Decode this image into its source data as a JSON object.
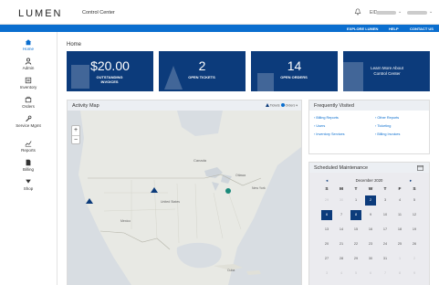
{
  "header": {
    "logo": "LUMEN",
    "app_title": "Control Center",
    "account_id": "EID"
  },
  "utility_links": [
    "EXPLORE LUMEN",
    "HELP",
    "CONTACT US"
  ],
  "sidebar": {
    "items": [
      {
        "label": "Home",
        "icon": "home-icon"
      },
      {
        "label": "Admin",
        "icon": "user-icon"
      },
      {
        "label": "Inventory",
        "icon": "list-icon"
      },
      {
        "label": "Orders",
        "icon": "cart-icon"
      },
      {
        "label": "Service Mgmt",
        "icon": "wrench-icon"
      },
      {
        "label": "Reports",
        "icon": "chart-icon"
      },
      {
        "label": "Billing",
        "icon": "document-icon"
      },
      {
        "label": "Shop",
        "icon": "cart-down-icon"
      }
    ]
  },
  "page": {
    "title": "Home"
  },
  "cards": [
    {
      "value": "$20.00",
      "label": "OUTSTANDING INVOICES"
    },
    {
      "value": "2",
      "label": "OPEN TICKETS"
    },
    {
      "value": "14",
      "label": "OPEN ORDERS"
    },
    {
      "note": "Learn More About Control Center"
    }
  ],
  "activity_map": {
    "title": "Activity Map",
    "legend": [
      "Tickets",
      "Orders"
    ],
    "zoom_in": "+",
    "zoom_out": "−",
    "place_labels": {
      "canada": "Canada",
      "ottawa": "Ottawa",
      "new_york": "New York",
      "united_states": "United States",
      "mexico": "Mexico",
      "cuba": "Cuba"
    }
  },
  "frequently_visited": {
    "title": "Frequently Visited",
    "links": [
      "Billing Reports",
      "Other Reports",
      "Users",
      "Ticketing",
      "Inventory Services",
      "Billing Invoices"
    ]
  },
  "scheduled_maintenance": {
    "title": "Scheduled Maintenance",
    "month": "December 2020",
    "prev": "◂",
    "next": "▸",
    "weekdays": [
      "S",
      "M",
      "T",
      "W",
      "T",
      "F",
      "S"
    ],
    "weeks": [
      [
        "29",
        "30",
        "1",
        "2",
        "3",
        "4",
        "5"
      ],
      [
        "6",
        "7",
        "8",
        "9",
        "10",
        "11",
        "12"
      ],
      [
        "13",
        "14",
        "15",
        "16",
        "17",
        "18",
        "19"
      ],
      [
        "20",
        "21",
        "22",
        "23",
        "24",
        "25",
        "26"
      ],
      [
        "27",
        "28",
        "29",
        "30",
        "31",
        "1",
        "2"
      ],
      [
        "3",
        "4",
        "5",
        "6",
        "7",
        "8",
        "9"
      ]
    ]
  },
  "colors": {
    "brand_blue": "#0a6ecf",
    "card_navy": "#0c3b7b",
    "ticket_marker": "#0c3b7b",
    "order_marker": "#1a8a7a"
  }
}
